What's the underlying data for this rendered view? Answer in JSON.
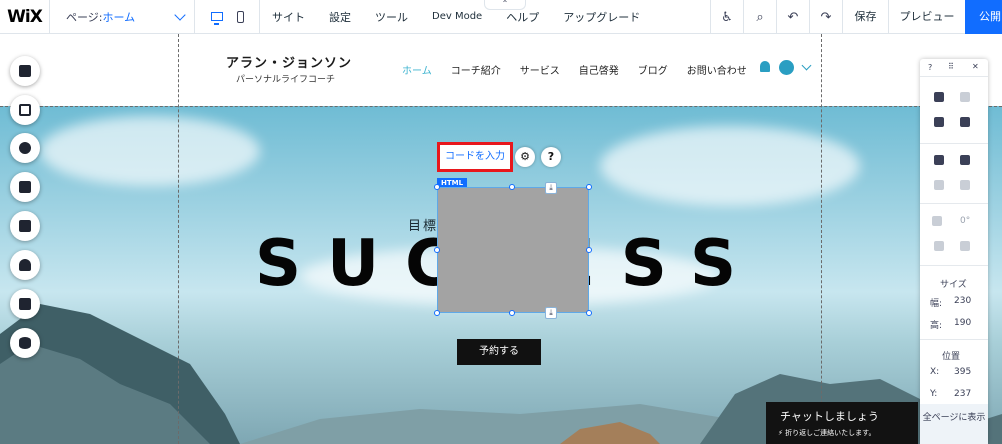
{
  "topbar": {
    "logo": "WiX",
    "page_label": "ページ:",
    "page_value": "ホーム",
    "menu": [
      "サイト",
      "設定",
      "ツール",
      "Dev Mode",
      "ヘルプ",
      "アップグレード"
    ],
    "save": "保存",
    "preview": "プレビュー",
    "publish": "公開"
  },
  "site": {
    "title": "アラン・ジョンソン",
    "subtitle": "パーソナルライフコーチ",
    "nav": [
      "ホーム",
      "コーチ紹介",
      "サービス",
      "自己啓発",
      "ブログ",
      "お問い合わせ"
    ]
  },
  "hero": {
    "goal_text": "目標に",
    "headline": "SUCCESS",
    "book_button": "予約する"
  },
  "html_widget": {
    "tag": "HTML",
    "code_button": "コードを入力",
    "settings_icon": "gear-icon",
    "help_icon": "question-icon"
  },
  "left_rail": [
    "menus-icon",
    "pages-icon",
    "add-icon",
    "apps-icon",
    "media-icon",
    "blog-icon",
    "bookings-icon",
    "database-icon"
  ],
  "panel": {
    "help": "?",
    "size_label": "サイズ",
    "width_label": "幅:",
    "width_value": "230",
    "height_label": "高:",
    "height_value": "190",
    "position_label": "位置",
    "x_label": "X:",
    "x_value": "395",
    "y_label": "Y:",
    "y_value": "237",
    "rotation": "0°",
    "all_pages": "全ページに表示"
  },
  "chat": {
    "title": "チャットしましょう",
    "subtitle": "折り返しご連絡いたします。"
  },
  "colors": {
    "accent": "#116dff",
    "highlight": "#e8171c",
    "site_accent": "#2a9ec2"
  }
}
